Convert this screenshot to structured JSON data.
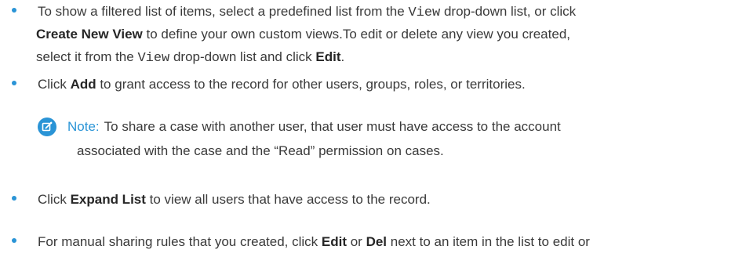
{
  "items": [
    {
      "line1_a": "To show a filtered list of items, select a predefined list from the ",
      "line1_code": "View",
      "line1_b": " drop-down list, or click",
      "line2_bold": "Create New View",
      "line2_rest": " to define your own custom views.To edit or delete any view you created,",
      "line3_a": "select it from the ",
      "line3_code": "View",
      "line3_b": " drop-down list and click ",
      "line3_bold": "Edit",
      "line3_end": "."
    },
    {
      "a": "Click ",
      "bold": "Add",
      "b": " to grant access to the record for other users, groups, roles, or territories."
    },
    {
      "a": "Click ",
      "bold": "Expand List",
      "b": " to view all users that have access to the record."
    },
    {
      "a": "For manual sharing rules that you created, click ",
      "bold1": "Edit",
      "mid": " or ",
      "bold2": "Del",
      "b": " next to an item in the list to edit or"
    }
  ],
  "note": {
    "icon": "note-edit-icon",
    "label": "Note:",
    "line1": "To share a case with another user, that user must have access to the account",
    "line2": "associated with the case and the “Read” permission on cases."
  },
  "colors": {
    "accent": "#2a94d6",
    "text": "#3a3a3a"
  }
}
